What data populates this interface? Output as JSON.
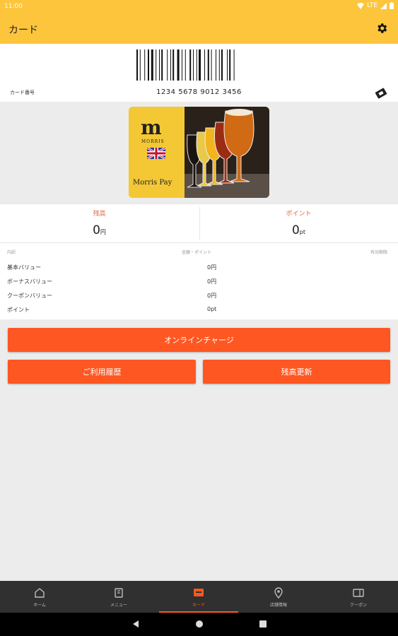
{
  "status_bar": {
    "time": "11:00",
    "network": "LTE"
  },
  "app_bar": {
    "title": "カード"
  },
  "barcode": {
    "label": "カード番号",
    "number": "1234 5678 9012 3456"
  },
  "card": {
    "brand": "MORRIS",
    "product": "Morris Pay"
  },
  "balance": {
    "left_label": "残高",
    "left_value": "0",
    "left_unit": "円",
    "right_label": "ポイント",
    "right_value": "0",
    "right_unit": "pt"
  },
  "details": {
    "headers": [
      "内訳",
      "金額・ポイント",
      "有効期限"
    ],
    "rows": [
      {
        "label": "基本バリュー",
        "value": "0円"
      },
      {
        "label": "ボーナスバリュー",
        "value": "0円"
      },
      {
        "label": "クーポンバリュー",
        "value": "0円"
      },
      {
        "label": "ポイント",
        "value": "0pt"
      }
    ]
  },
  "buttons": {
    "charge": "オンラインチャージ",
    "history": "ご利用履歴",
    "refresh": "残高更新"
  },
  "bottom_nav": {
    "active_index": 2,
    "items": [
      {
        "label": "ホーム",
        "icon": "home-icon"
      },
      {
        "label": "メニュー",
        "icon": "menu-book-icon"
      },
      {
        "label": "カード",
        "icon": "card-icon"
      },
      {
        "label": "店舗情報",
        "icon": "location-pin-icon"
      },
      {
        "label": "クーポン",
        "icon": "coupon-icon"
      }
    ]
  },
  "colors": {
    "app_bar": "#fcc53c",
    "accent": "#ff5722",
    "nav_bg": "#303030"
  }
}
